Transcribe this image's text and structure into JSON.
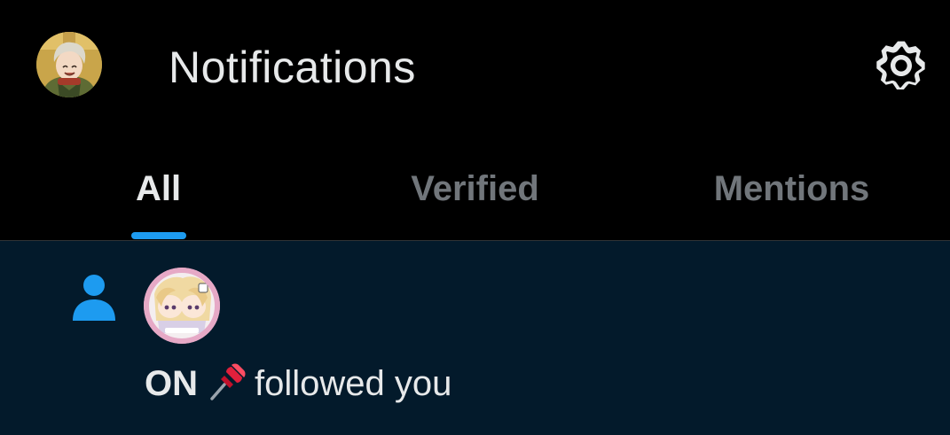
{
  "header": {
    "title": "Notifications",
    "avatar_icon": "user-avatar-icon",
    "settings_icon": "gear-icon"
  },
  "tabs": [
    {
      "label": "All",
      "active": true
    },
    {
      "label": "Verified",
      "active": false
    },
    {
      "label": "Mentions",
      "active": false
    }
  ],
  "notifications": [
    {
      "type": "follow",
      "icon": "person-icon",
      "user_name": "ON",
      "name_emoji_icon": "pushpin-icon",
      "action_text": "followed you"
    }
  ],
  "colors": {
    "background": "#000000",
    "accent": "#1d9bf0",
    "text_primary": "#e7e9ea",
    "text_secondary": "#71767b",
    "unread_background": "#031a2b"
  }
}
